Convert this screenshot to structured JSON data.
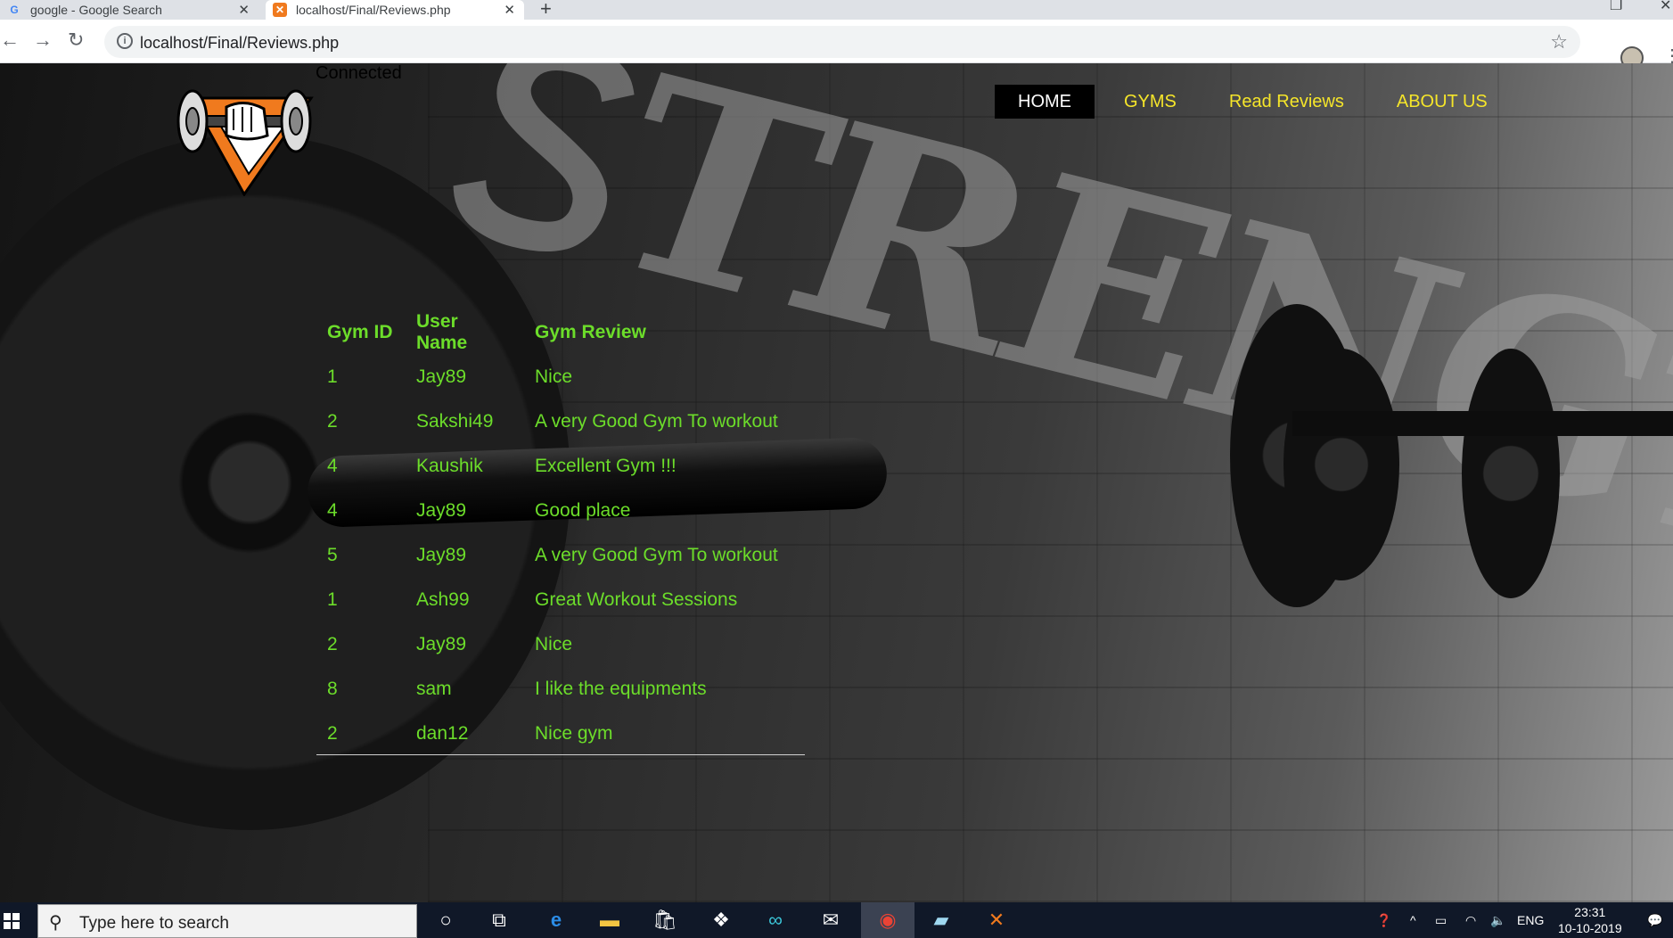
{
  "browser": {
    "tabs": [
      {
        "title": "google - Google Search",
        "favicon": "google-icon"
      },
      {
        "title": "localhost/Final/Reviews.php",
        "favicon": "xampp-icon"
      }
    ],
    "url": "localhost/Final/Reviews.php"
  },
  "page": {
    "status_text": "Connected",
    "nav": {
      "home": "HOME",
      "gyms": "GYMS",
      "read_reviews": "Read Reviews",
      "about_us": "ABOUT US"
    },
    "table": {
      "headers": [
        "Gym ID",
        "User Name",
        "Gym Review"
      ],
      "rows": [
        [
          "1",
          "Jay89",
          "Nice"
        ],
        [
          "2",
          "Sakshi49",
          "A very Good Gym To workout"
        ],
        [
          "4",
          "Kaushik",
          "Excellent Gym !!!"
        ],
        [
          "4",
          "Jay89",
          "Good place"
        ],
        [
          "5",
          "Jay89",
          "A very Good Gym To workout"
        ],
        [
          "1",
          "Ash99",
          "Great Workout Sessions"
        ],
        [
          "2",
          "Jay89",
          "Nice"
        ],
        [
          "8",
          "sam",
          "I like the equipments"
        ],
        [
          "2",
          "dan12",
          "Nice gym"
        ]
      ]
    },
    "colors": {
      "table_text": "#6cdd2a",
      "nav_text": "#f5e52a",
      "nav_active_bg": "#000000",
      "logo_orange": "#f07a1e"
    }
  },
  "taskbar": {
    "search_placeholder": "Type here to search",
    "language": "ENG",
    "time": "23:31",
    "date": "10-10-2019"
  }
}
